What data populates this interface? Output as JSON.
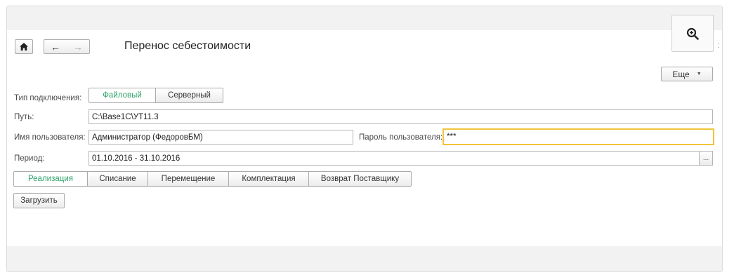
{
  "header": {
    "title": "Перенос себестоимости",
    "home_icon": "home-icon",
    "back_icon": "arrow-left-icon",
    "forward_icon": "arrow-right-icon",
    "zoom_icon": "zoom-in-icon",
    "more_label": "Еще",
    "colon": ":"
  },
  "connection": {
    "label": "Тип подключения:",
    "options": [
      "Файловый",
      "Серверный"
    ],
    "selected": "Файловый"
  },
  "path": {
    "label": "Путь:",
    "value": "C:\\Base1C\\УТ11.3"
  },
  "user": {
    "label": "Имя пользователя:",
    "value": "Администратор (ФедоровБМ)"
  },
  "password": {
    "label": "Пароль пользователя:",
    "value": "***"
  },
  "period": {
    "label": "Период:",
    "value": "01.10.2016 - 31.10.2016",
    "button": "..."
  },
  "tabs": {
    "items": [
      "Реализация",
      "Списание",
      "Перемещение",
      "Комплектация",
      "Возврат Поставщику"
    ],
    "selected": "Реализация"
  },
  "actions": {
    "load_label": "Загрузить"
  },
  "colors": {
    "accent": "#2fa36a",
    "focus_border": "#f0c53a"
  }
}
